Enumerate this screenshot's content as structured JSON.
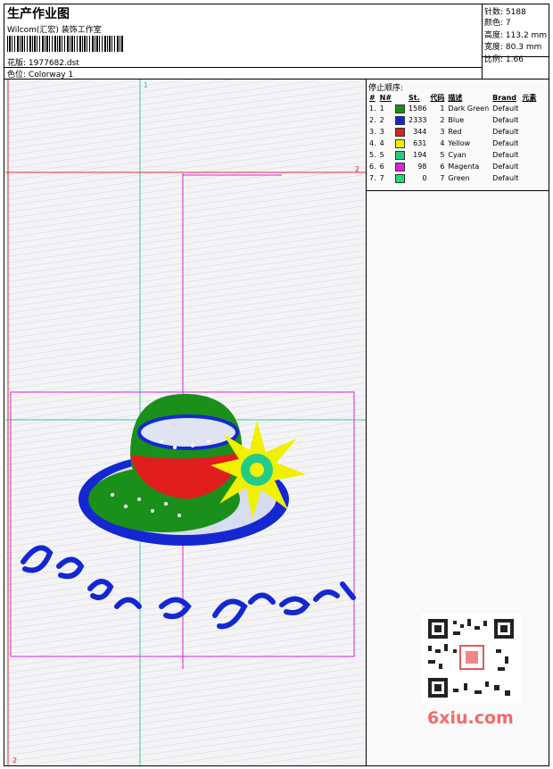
{
  "header": {
    "title": "生产作业图",
    "company": "Wilcom(汇宏) 装饰工作室",
    "design_label": "花版:",
    "design_value": "1977682.dst",
    "colorway_label": "色位:",
    "colorway_value": "Colorway 1"
  },
  "stats": [
    {
      "label": "针数:",
      "value": "5188"
    },
    {
      "label": "颜色:",
      "value": "7"
    },
    {
      "label": "高度:",
      "value": "113.2 mm"
    },
    {
      "label": "宽度:",
      "value": "80.3 mm"
    },
    {
      "label": "比例:",
      "value": "1.66"
    }
  ],
  "stop_sequence": {
    "title": "停止顺序:",
    "columns": [
      "#",
      "N#",
      "St.",
      "代码",
      "描述",
      "Brand",
      "元素"
    ],
    "rows": [
      {
        "idx": "1.",
        "n": "1",
        "color": "#1a8f1a",
        "st": "1586",
        "code": "1",
        "desc": "Dark Green",
        "brand": "Default"
      },
      {
        "idx": "2.",
        "n": "2",
        "color": "#1428d2",
        "st": "2333",
        "code": "2",
        "desc": "Blue",
        "brand": "Default"
      },
      {
        "idx": "3.",
        "n": "3",
        "color": "#e01e1e",
        "st": "344",
        "code": "3",
        "desc": "Red",
        "brand": "Default"
      },
      {
        "idx": "4.",
        "n": "4",
        "color": "#f0f000",
        "st": "631",
        "code": "4",
        "desc": "Yellow",
        "brand": "Default"
      },
      {
        "idx": "5.",
        "n": "5",
        "color": "#22cc88",
        "st": "194",
        "code": "5",
        "desc": "Cyan",
        "brand": "Default"
      },
      {
        "idx": "6.",
        "n": "6",
        "color": "#e020e0",
        "st": "98",
        "code": "6",
        "desc": "Magenta",
        "brand": "Default"
      },
      {
        "idx": "7.",
        "n": "7",
        "color": "#22dd77",
        "st": "0",
        "code": "7",
        "desc": "Green",
        "brand": "Default"
      }
    ]
  },
  "guides": {
    "label_1": "1",
    "label_2": "2"
  },
  "watermark": "6xiu.com"
}
